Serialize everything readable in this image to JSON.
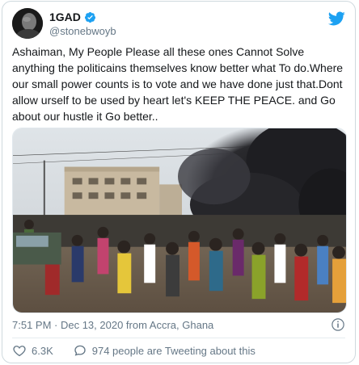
{
  "author": {
    "name": "1GAD",
    "handle": "@stonebwoyb",
    "verified": true
  },
  "tweet": {
    "text": "Ashaiman, My People Please all these ones Cannot Solve anything the politicains themselves know better what To do.Where our small power counts is to vote and we have done just that.Dont allow urself to be used by heart let's KEEP THE PEACE. and Go about our hustle it Go better..",
    "timestamp": "7:51 PM · Dec 13, 2020 from Accra, Ghana"
  },
  "actions": {
    "likes": "6.3K",
    "conversation": "974 people are Tweeting about this"
  },
  "colors": {
    "accent": "#1da1f2",
    "secondary_text": "#657786",
    "like_red": "#e0245e"
  },
  "icons": [
    "verified-badge-icon",
    "twitter-bird-icon",
    "info-icon",
    "heart-icon",
    "speech-bubble-icon"
  ]
}
